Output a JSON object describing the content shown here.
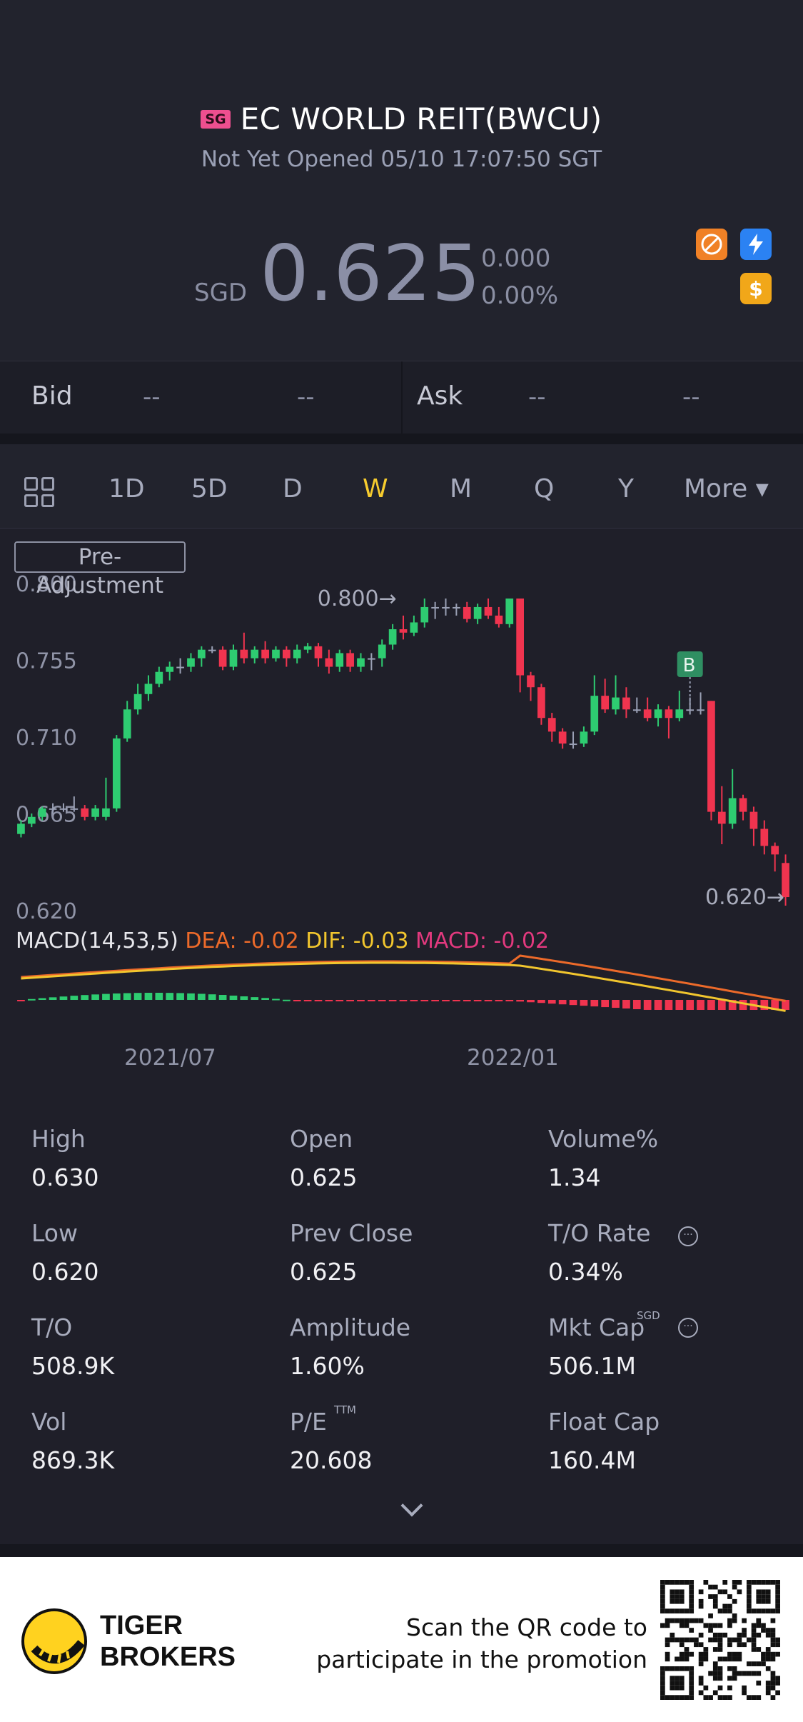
{
  "header": {
    "market_badge": "SG",
    "stock_name": "EC WORLD REIT(BWCU)",
    "status": "Not Yet Opened 05/10 17:07:50 SGT",
    "currency": "SGD",
    "price": "0.625",
    "change": "0.000",
    "change_pct": "0.00%",
    "icons": [
      "no-short-icon",
      "lightning-icon",
      "dollar-icon"
    ]
  },
  "bidask": {
    "bid_label": "Bid",
    "bid_price": "--",
    "bid_size": "--",
    "ask_label": "Ask",
    "ask_price": "--",
    "ask_size": "--"
  },
  "tabs": {
    "items": [
      "1D",
      "5D",
      "D",
      "W",
      "M",
      "Q",
      "Y",
      "More ▾"
    ],
    "active": "W"
  },
  "chart": {
    "pre_adjustment_label": "Pre-Adjustment",
    "y_labels": [
      "0.800",
      "0.755",
      "0.710",
      "0.665",
      "0.620"
    ],
    "high_marker": "0.800",
    "low_marker": "0.620",
    "buy_marker": "B",
    "x_labels": [
      "2021/07",
      "2022/01"
    ],
    "macd_title": "MACD(14,53,5)",
    "dea": "DEA: -0.02",
    "dif": "DIF: -0.03",
    "macd": "MACD: -0.02",
    "colors": {
      "up": "#2ecc71",
      "down": "#f0344f",
      "dea": "#ec6a2a",
      "dif": "#f2c62e",
      "macd": "#e2397e"
    }
  },
  "chart_data": {
    "type": "candlestick",
    "ylim": [
      0.62,
      0.8
    ],
    "x_ticks": [
      "2021/07",
      "2022/01"
    ],
    "candles": [
      [
        0.662,
        0.668,
        0.67,
        0.66
      ],
      [
        0.668,
        0.672,
        0.674,
        0.666
      ],
      [
        0.672,
        0.677,
        0.678,
        0.67
      ],
      [
        0.677,
        0.677,
        0.68,
        0.674
      ],
      [
        0.677,
        0.677,
        0.68,
        0.675
      ],
      [
        0.677,
        0.677,
        0.684,
        0.675
      ],
      [
        0.677,
        0.672,
        0.679,
        0.67
      ],
      [
        0.672,
        0.677,
        0.679,
        0.67
      ],
      [
        0.672,
        0.677,
        0.695,
        0.67
      ],
      [
        0.677,
        0.718,
        0.72,
        0.675
      ],
      [
        0.718,
        0.735,
        0.74,
        0.716
      ],
      [
        0.735,
        0.744,
        0.75,
        0.732
      ],
      [
        0.744,
        0.75,
        0.755,
        0.74
      ],
      [
        0.75,
        0.757,
        0.76,
        0.748
      ],
      [
        0.757,
        0.76,
        0.763,
        0.752
      ],
      [
        0.76,
        0.76,
        0.765,
        0.756
      ],
      [
        0.76,
        0.765,
        0.768,
        0.757
      ],
      [
        0.765,
        0.77,
        0.772,
        0.76
      ],
      [
        0.77,
        0.77,
        0.772,
        0.768
      ],
      [
        0.77,
        0.76,
        0.772,
        0.758
      ],
      [
        0.76,
        0.77,
        0.773,
        0.758
      ],
      [
        0.77,
        0.765,
        0.78,
        0.762
      ],
      [
        0.765,
        0.77,
        0.772,
        0.762
      ],
      [
        0.77,
        0.765,
        0.775,
        0.762
      ],
      [
        0.765,
        0.77,
        0.772,
        0.763
      ],
      [
        0.77,
        0.765,
        0.772,
        0.76
      ],
      [
        0.765,
        0.77,
        0.773,
        0.762
      ],
      [
        0.77,
        0.772,
        0.774,
        0.768
      ],
      [
        0.772,
        0.765,
        0.774,
        0.76
      ],
      [
        0.765,
        0.76,
        0.77,
        0.756
      ],
      [
        0.76,
        0.768,
        0.77,
        0.757
      ],
      [
        0.768,
        0.76,
        0.77,
        0.757
      ],
      [
        0.76,
        0.765,
        0.768,
        0.757
      ],
      [
        0.765,
        0.765,
        0.768,
        0.758
      ],
      [
        0.765,
        0.773,
        0.776,
        0.76
      ],
      [
        0.773,
        0.782,
        0.785,
        0.77
      ],
      [
        0.782,
        0.78,
        0.79,
        0.776
      ],
      [
        0.78,
        0.786,
        0.79,
        0.778
      ],
      [
        0.786,
        0.795,
        0.8,
        0.783
      ],
      [
        0.795,
        0.795,
        0.798,
        0.788
      ],
      [
        0.795,
        0.795,
        0.8,
        0.79
      ],
      [
        0.795,
        0.795,
        0.797,
        0.79
      ],
      [
        0.795,
        0.788,
        0.798,
        0.786
      ],
      [
        0.788,
        0.795,
        0.797,
        0.785
      ],
      [
        0.795,
        0.79,
        0.8,
        0.788
      ],
      [
        0.79,
        0.785,
        0.795,
        0.783
      ],
      [
        0.785,
        0.8,
        0.8,
        0.783
      ],
      [
        0.8,
        0.755,
        0.8,
        0.745
      ],
      [
        0.755,
        0.748,
        0.757,
        0.74
      ],
      [
        0.748,
        0.73,
        0.75,
        0.726
      ],
      [
        0.73,
        0.722,
        0.733,
        0.716
      ],
      [
        0.722,
        0.715,
        0.724,
        0.712
      ],
      [
        0.715,
        0.715,
        0.722,
        0.712
      ],
      [
        0.715,
        0.722,
        0.725,
        0.713
      ],
      [
        0.722,
        0.743,
        0.755,
        0.72
      ],
      [
        0.743,
        0.735,
        0.753,
        0.733
      ],
      [
        0.735,
        0.742,
        0.755,
        0.732
      ],
      [
        0.742,
        0.735,
        0.748,
        0.73
      ],
      [
        0.735,
        0.735,
        0.742,
        0.733
      ],
      [
        0.735,
        0.73,
        0.742,
        0.728
      ],
      [
        0.73,
        0.735,
        0.738,
        0.725
      ],
      [
        0.735,
        0.73,
        0.737,
        0.718
      ],
      [
        0.73,
        0.735,
        0.746,
        0.728
      ],
      [
        0.735,
        0.735,
        0.742,
        0.732
      ],
      [
        0.735,
        0.735,
        0.745,
        0.732
      ],
      [
        0.74,
        0.675,
        0.74,
        0.67
      ],
      [
        0.675,
        0.668,
        0.69,
        0.656
      ],
      [
        0.668,
        0.683,
        0.7,
        0.665
      ],
      [
        0.683,
        0.675,
        0.685,
        0.67
      ],
      [
        0.675,
        0.665,
        0.678,
        0.655
      ],
      [
        0.665,
        0.655,
        0.67,
        0.65
      ],
      [
        0.655,
        0.65,
        0.657,
        0.64
      ],
      [
        0.645,
        0.625,
        0.65,
        0.62
      ]
    ],
    "macd": {
      "title": "MACD(14,53,5)",
      "dea": -0.02,
      "dif": -0.03,
      "macd": -0.02
    },
    "annotations": [
      "0.800",
      "0.620",
      "B"
    ]
  },
  "stats": [
    {
      "label": "High",
      "value": "0.630"
    },
    {
      "label": "Open",
      "value": "0.625"
    },
    {
      "label": "Volume%",
      "value": "1.34"
    },
    {
      "label": "Low",
      "value": "0.620"
    },
    {
      "label": "Prev Close",
      "value": "0.625"
    },
    {
      "label": "T/O Rate",
      "value": "0.34%"
    },
    {
      "label": "T/O",
      "value": "508.9K"
    },
    {
      "label": "Amplitude",
      "value": "1.60%"
    },
    {
      "label": "Mkt Cap",
      "value": "506.1M"
    },
    {
      "label": "Vol",
      "value": "869.3K"
    },
    {
      "label": "P/E",
      "value": "20.608"
    },
    {
      "label": "Float Cap",
      "value": "160.4M"
    }
  ],
  "stat_superscripts": {
    "mkt_cap": "SGD",
    "pe": "TTM"
  },
  "info_glyph": "···",
  "footer": {
    "brand_line1": "TIGER",
    "brand_line2": "BROKERS",
    "promo_line1": "Scan the QR code to",
    "promo_line2": "participate in the promotion"
  }
}
